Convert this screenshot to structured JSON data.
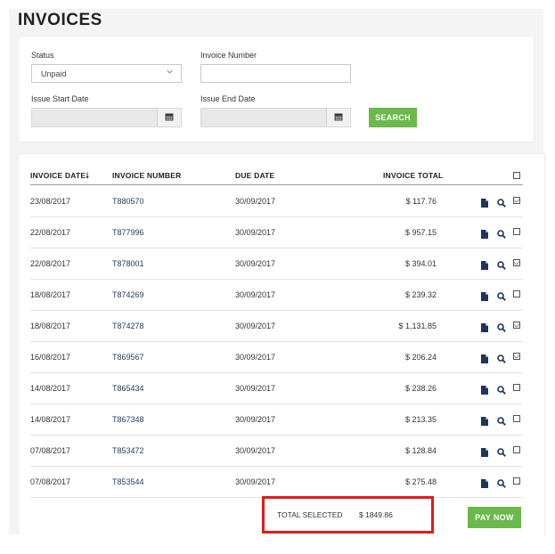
{
  "page": {
    "title": "INVOICES"
  },
  "filters": {
    "status_label": "Status",
    "status_value": "Unpaid",
    "invoice_number_label": "Invoice Number",
    "invoice_number_value": "",
    "issue_start_label": "Issue Start Date",
    "issue_end_label": "Issue End Date",
    "search_label": "SEARCH"
  },
  "table": {
    "columns": {
      "invoice_date": "INVOICE DATE",
      "sort_arrow": "🠗",
      "invoice_number": "INVOICE NUMBER",
      "due_date": "DUE DATE",
      "invoice_total": "INVOICE TOTAL"
    },
    "rows": [
      {
        "date": "23/08/2017",
        "number": "T880570",
        "due": "30/09/2017",
        "total": "$ 117.76",
        "checked": true
      },
      {
        "date": "22/08/2017",
        "number": "T877996",
        "due": "30/09/2017",
        "total": "$ 957.15",
        "checked": false
      },
      {
        "date": "22/08/2017",
        "number": "T878001",
        "due": "30/09/2017",
        "total": "$ 394.01",
        "checked": true
      },
      {
        "date": "18/08/2017",
        "number": "T874269",
        "due": "30/09/2017",
        "total": "$ 239.32",
        "checked": false
      },
      {
        "date": "18/08/2017",
        "number": "T874278",
        "due": "30/09/2017",
        "total": "$ 1,131.85",
        "checked": true
      },
      {
        "date": "16/08/2017",
        "number": "T869567",
        "due": "30/09/2017",
        "total": "$ 206.24",
        "checked": true
      },
      {
        "date": "14/08/2017",
        "number": "T865434",
        "due": "30/09/2017",
        "total": "$ 238.26",
        "checked": false
      },
      {
        "date": "14/08/2017",
        "number": "T867348",
        "due": "30/09/2017",
        "total": "$ 213.35",
        "checked": false
      },
      {
        "date": "07/08/2017",
        "number": "T853472",
        "due": "30/09/2017",
        "total": "$ 128.84",
        "checked": false
      },
      {
        "date": "07/08/2017",
        "number": "T853544",
        "due": "30/09/2017",
        "total": "$ 275.48",
        "checked": false
      }
    ]
  },
  "footer": {
    "total_selected_label": "TOTAL SELECTED",
    "total_selected_value": "$ 1849.86",
    "pay_now_label": "PAY NOW"
  },
  "colors": {
    "accent_green": "#6ab94a",
    "link_blue": "#1f3b5e",
    "highlight_red": "#e01b1b",
    "icon_navy": "#1d3557"
  },
  "icons": {
    "row_actions": [
      "document-icon",
      "magnifier-icon",
      "checkbox"
    ],
    "date_picker": "calendar-icon",
    "select": "chevron-down-icon"
  }
}
